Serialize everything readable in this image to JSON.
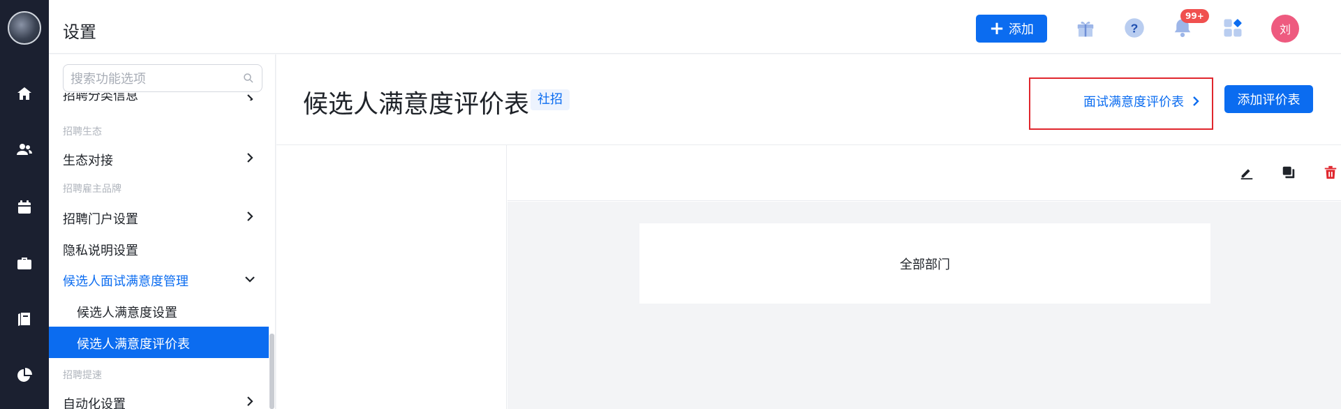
{
  "header": {
    "title": "设置",
    "add_label": "添加",
    "notification_badge": "99+",
    "avatar_text": "刘"
  },
  "sidebar": {
    "search_placeholder": "搜索功能选项",
    "items": [
      {
        "label": "招聘分类信息"
      },
      {
        "group": "招聘生态"
      },
      {
        "label": "生态对接"
      },
      {
        "group": "招聘雇主品牌"
      },
      {
        "label": "招聘门户设置"
      },
      {
        "label": "隐私说明设置"
      },
      {
        "label": "候选人面试满意度管理"
      },
      {
        "label": "候选人满意度设置"
      },
      {
        "label": "候选人满意度评价表"
      },
      {
        "group": "招聘提速"
      },
      {
        "label": "自动化设置"
      }
    ]
  },
  "main": {
    "title": "候选人满意度评价表",
    "tag": "社招",
    "link_label": "面试满意度评价表",
    "add_form_label": "添加评价表",
    "card_text": "全部部门"
  },
  "colors": {
    "primary": "#0b6cf0",
    "rail_bg": "#1b2030",
    "danger": "#e0262d",
    "avatar": "#ee5a7f"
  }
}
